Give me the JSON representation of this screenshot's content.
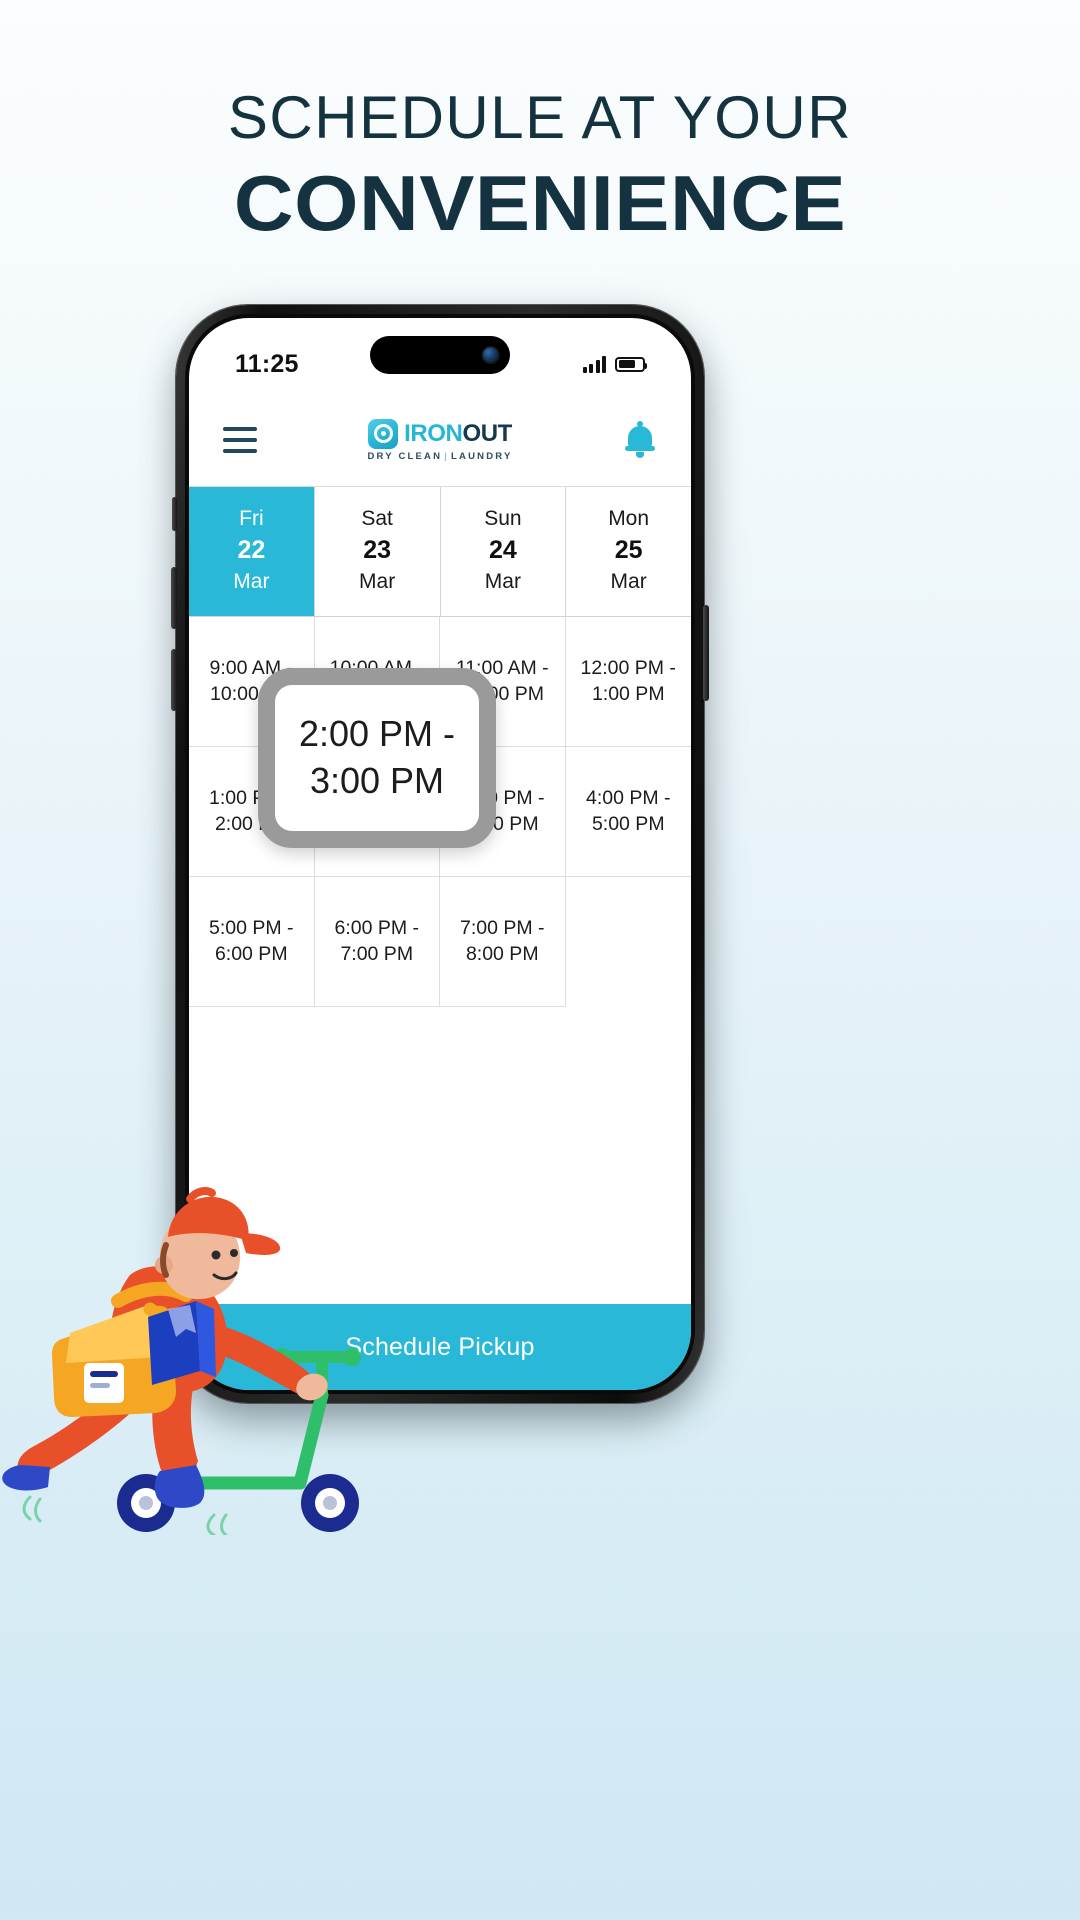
{
  "promo": {
    "line1": "SCHEDULE AT YOUR",
    "line2": "CONVENIENCE",
    "heading_color": "#14323F"
  },
  "phone": {
    "status_bar": {
      "time": "11:25",
      "signal_icon": "cellular-bars-icon",
      "battery_icon": "battery-icon",
      "battery_level": "72"
    }
  },
  "app": {
    "header": {
      "menu_icon": "hamburger-menu-icon",
      "logo": {
        "mark_icon": "ironout-washer-icon",
        "name_part1": "IRON",
        "name_part2": "OUT",
        "tagline_left": "DRY CLEAN",
        "tagline_sep": "|",
        "tagline_right": "LAUNDRY",
        "accent_color": "#29B8D8",
        "dark_color": "#163A4C"
      },
      "notification_icon": "bell-icon"
    },
    "dates": [
      {
        "dow": "Fri",
        "day": "22",
        "month": "Mar",
        "selected": true
      },
      {
        "dow": "Sat",
        "day": "23",
        "month": "Mar",
        "selected": false
      },
      {
        "dow": "Sun",
        "day": "24",
        "month": "Mar",
        "selected": false
      },
      {
        "dow": "Mon",
        "day": "25",
        "month": "Mar",
        "selected": false
      }
    ],
    "slots": [
      "9:00 AM - 10:00 AM",
      "10:00 AM - 11:00 AM",
      "11:00 AM - 12:00 PM",
      "12:00 PM - 1:00 PM",
      "1:00 PM - 2:00 PM",
      "2:00 PM - 3:00 PM",
      "3:00 PM - 4:00 PM",
      "4:00 PM - 5:00 PM",
      "5:00 PM - 6:00 PM",
      "6:00 PM - 7:00 PM",
      "7:00 PM - 8:00 PM"
    ],
    "cta_label": "Schedule Pickup"
  },
  "magnifier": {
    "line1": "2:00 PM -",
    "line2": "3:00 PM",
    "border_color": "#9A9A9A"
  },
  "illustration": {
    "name": "courier-on-scooter-illustration",
    "scooter_color": "#2FBF6B",
    "uniform_color": "#E8502A",
    "bag_color": "#F5A623",
    "shoe_color": "#2E49C8"
  }
}
